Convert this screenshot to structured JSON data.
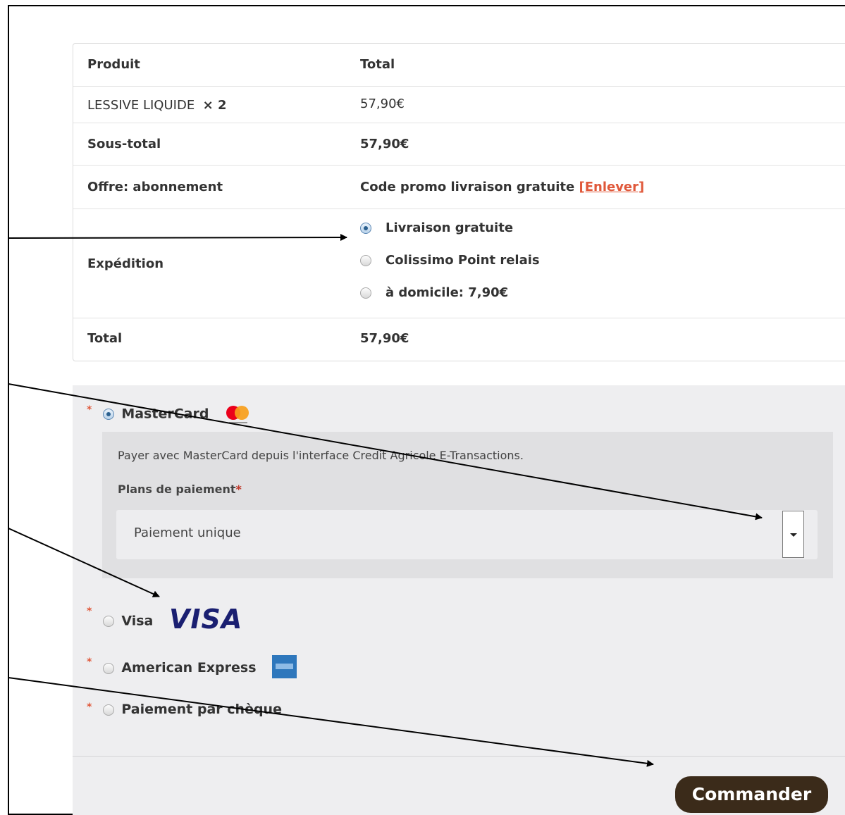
{
  "order": {
    "header": {
      "product": "Produit",
      "total": "Total"
    },
    "item": {
      "name": "LESSIVE LIQUIDE",
      "qty": "× 2",
      "price": "57,90€"
    },
    "subtotal": {
      "label": "Sous-total",
      "value": "57,90€"
    },
    "offer": {
      "label": "Offre: abonnement",
      "value": "Code promo livraison gratuite",
      "remove": "[Enlever]"
    },
    "shipping": {
      "label": "Expédition",
      "options": [
        {
          "label": "Livraison gratuite",
          "selected": true
        },
        {
          "label": "Colissimo Point relais",
          "selected": false
        },
        {
          "label": "à domicile: 7,90€",
          "selected": false
        }
      ]
    },
    "total": {
      "label": "Total",
      "value": "57,90€"
    }
  },
  "payment": {
    "required_mark": "*",
    "methods": [
      {
        "label": "MasterCard",
        "selected": true,
        "icon": "mastercard-icon"
      },
      {
        "label": "Visa",
        "selected": false,
        "icon": "visa-logo"
      },
      {
        "label": "American Express",
        "selected": false,
        "icon": "amex-icon"
      },
      {
        "label": "Paiement par chèque",
        "selected": false
      }
    ],
    "mastercard_box": {
      "description": "Payer avec MasterCard depuis l'interface Credit Agricole E-Transactions.",
      "plans_label": "Plans de paiement",
      "plans_required": "*",
      "selected_plan": "Paiement unique"
    },
    "submit_label": "Commander",
    "visa_logo_text": "VISA"
  },
  "colors": {
    "accent": "#e0583a",
    "button": "#3b2b1a",
    "payment_bg": "#eeeef0",
    "visa_blue": "#1a1f71"
  }
}
